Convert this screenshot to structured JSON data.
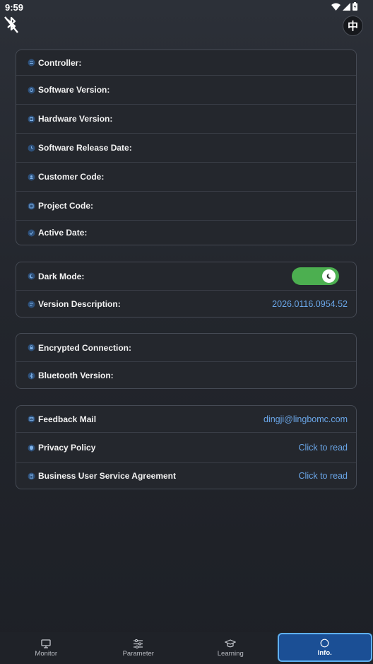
{
  "status_bar": {
    "time": "9:59"
  },
  "header": {
    "language_label": "中"
  },
  "device_info": [
    {
      "icon": "controller-icon",
      "label": "Controller:"
    },
    {
      "icon": "software-version-icon",
      "label": "Software Version:"
    },
    {
      "icon": "hardware-version-icon",
      "label": "Hardware Version:"
    },
    {
      "icon": "release-date-icon",
      "label": "Software Release Date:"
    },
    {
      "icon": "customer-code-icon",
      "label": "Customer Code:"
    },
    {
      "icon": "project-code-icon",
      "label": "Project Code:"
    },
    {
      "icon": "active-date-icon",
      "label": "Active Date:"
    }
  ],
  "app_settings": {
    "dark_mode_label": "Dark Mode:",
    "dark_mode_on": true,
    "version_description_label": "Version Description:",
    "version_description_value": "2026.0116.0954.52"
  },
  "connection": {
    "encrypted_label": "Encrypted Connection:",
    "bluetooth_version_label": "Bluetooth Version:"
  },
  "support": {
    "feedback_label": "Feedback Mail",
    "feedback_value": "dingji@lingbomc.com",
    "privacy_label": "Privacy Policy",
    "privacy_value": "Click to read",
    "agreement_label": "Business User Service Agreement",
    "agreement_value": "Click to read"
  },
  "nav": [
    {
      "label": "Monitor",
      "icon": "monitor-icon",
      "active": false
    },
    {
      "label": "Parameter",
      "icon": "sliders-icon",
      "active": false
    },
    {
      "label": "Learning",
      "icon": "graduation-cap-icon",
      "active": false
    },
    {
      "label": "Info.",
      "icon": "info-icon",
      "active": true
    }
  ],
  "colors": {
    "accent_link": "#6aa6e8",
    "toggle_on": "#4caf50",
    "nav_active": "#1b4f95"
  }
}
